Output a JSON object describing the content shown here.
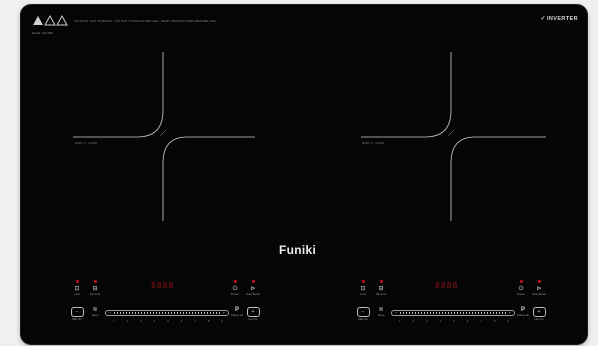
{
  "top": {
    "warning_text": "CAUTION: HOT SURFACE - DO NOT TOUCH AFTER USE - READ INSTRUCTIONS BEFORE USE",
    "model": "Model: HIP-256",
    "inverter": "INVERTER"
  },
  "zones": [
    {
      "label": "Φ200 | 1 - 2100W"
    },
    {
      "label": "Φ200 | 2 - 2100W"
    }
  ],
  "brand": "Funiki",
  "colors": {
    "glass": "#050505",
    "indicator": "#c1121b",
    "text": "#dcdcdc"
  },
  "left_panel": {
    "display": "8888",
    "lock_label": "Lock",
    "timer_label": "Set time",
    "power_label": "Power",
    "auto_label": "Auto Boost",
    "minus_label": "Mild fire",
    "keep_label": "Keep",
    "pause_label": "P",
    "pause_sub": "Pause all",
    "plus_label": "Hot fire",
    "scale": [
      "1",
      "2",
      "3",
      "4",
      "5",
      "6",
      "7",
      "8",
      "9"
    ]
  },
  "right_panel": {
    "display": "8888",
    "lock_label": "Lock",
    "timer_label": "Set time",
    "power_label": "Power",
    "auto_label": "Auto Boost",
    "minus_label": "Mild fire",
    "keep_label": "Keep",
    "pause_label": "P",
    "pause_sub": "Pause all",
    "plus_label": "Hot fire",
    "scale": [
      "1",
      "2",
      "3",
      "4",
      "5",
      "6",
      "7",
      "8",
      "9"
    ]
  }
}
